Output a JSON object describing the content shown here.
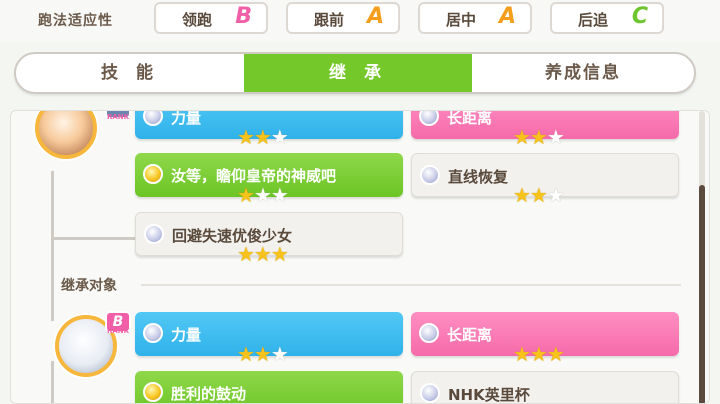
{
  "aptitude": {
    "label": "跑法适应性",
    "items": [
      {
        "name": "领跑",
        "grade": "B"
      },
      {
        "name": "跟前",
        "grade": "A"
      },
      {
        "name": "居中",
        "grade": "A"
      },
      {
        "name": "后追",
        "grade": "C"
      }
    ]
  },
  "tabs": [
    {
      "label": "技 能",
      "active": false
    },
    {
      "label": "继 承",
      "active": true
    },
    {
      "label": "养成信息",
      "active": false
    }
  ],
  "parent1": {
    "rank": "RANK",
    "cards": [
      {
        "label": "力量",
        "color": "blue",
        "stars": 2
      },
      {
        "label": "长距离",
        "color": "pink",
        "stars": 2
      },
      {
        "label": "汝等，瞻仰皇帝的神威吧",
        "color": "green",
        "stars": 1
      },
      {
        "label": "直线恢复",
        "color": "white",
        "stars": 2
      },
      {
        "label": "回避失速优俊少女",
        "color": "white",
        "stars": 3
      }
    ]
  },
  "section_label": "继承对象",
  "parent2": {
    "rank_grade": "B",
    "rank": "RANK",
    "cards": [
      {
        "label": "力量",
        "color": "blue",
        "stars": 2
      },
      {
        "label": "长距离",
        "color": "pink",
        "stars": 3
      },
      {
        "label": "胜利的鼓动",
        "color": "green",
        "stars": 0
      },
      {
        "label": "NHK英里杯",
        "color": "white",
        "stars": 0
      }
    ]
  },
  "colors": {
    "accent": "#74c82a",
    "grade_b": "#f05fa7",
    "grade_a": "#f59e1c",
    "grade_c": "#6ec62f"
  }
}
